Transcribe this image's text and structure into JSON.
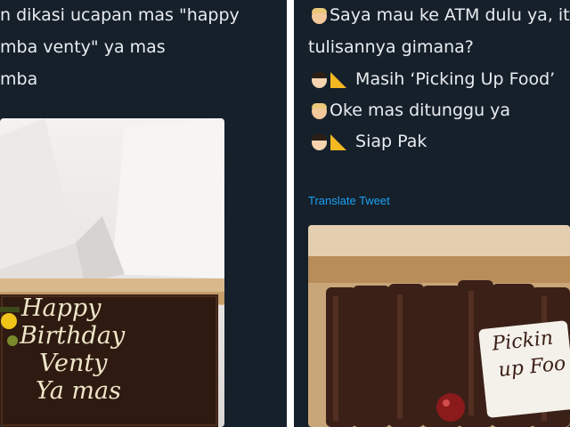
{
  "left_tweet": {
    "lines": [
      "n dikasi ucapan mas  \"happy",
      "mba venty\" ya mas",
      "mba"
    ],
    "photo": {
      "plaque_lines": [
        "Happy",
        "Birthday",
        "Venty",
        "Ya mas"
      ],
      "colors": {
        "box": "#f1efee",
        "chocolate": "#2e1a10",
        "piping": "#efe6c9"
      }
    }
  },
  "right_tweet": {
    "chat_lines": [
      {
        "speaker": "customer",
        "icon": "blond-person-icon",
        "text": "Saya mau ke ATM dulu ya, it"
      },
      {
        "speaker": "customer",
        "icon": "",
        "text": "tulisannya gimana?"
      },
      {
        "speaker": "driver",
        "icon": "driver-cheese-icon",
        "text": "Masih ‘Picking Up Food’"
      },
      {
        "speaker": "customer",
        "icon": "blond-person-icon",
        "text": "Oke mas ditunggu ya"
      },
      {
        "speaker": "driver",
        "icon": "driver-cheese-icon",
        "text": "Siap Pak"
      }
    ],
    "translate_label": "Translate Tweet",
    "photo": {
      "plaque_lines": [
        "Pickin",
        "up Foo"
      ],
      "colors": {
        "tray": "#c9a679",
        "chocolate": "#3b2018",
        "plaque": "#f4f1ea"
      }
    }
  },
  "colors": {
    "dark_bg": "#15202b",
    "text": "#e9ecef",
    "link": "#1da1f2"
  }
}
